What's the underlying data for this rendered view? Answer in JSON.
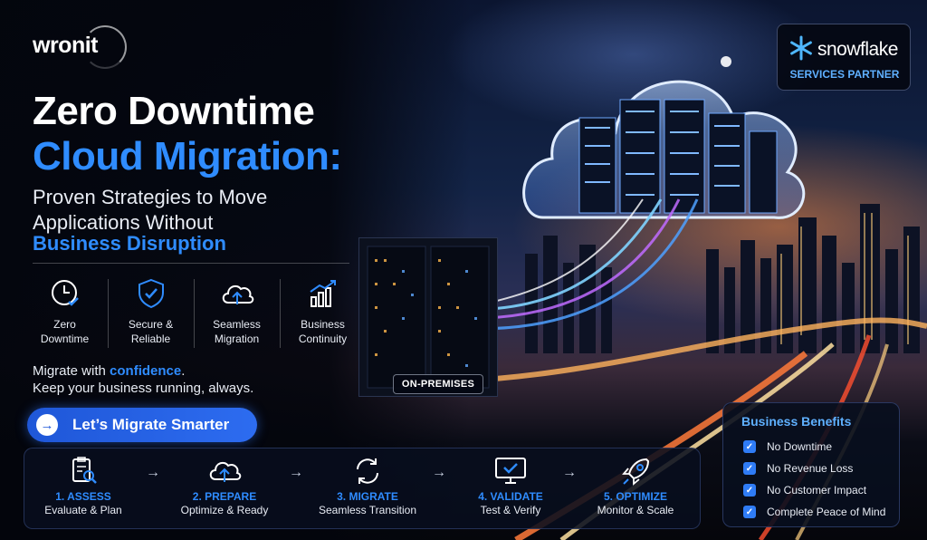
{
  "brand": {
    "name": "wronit"
  },
  "headline": {
    "line1": "Zero Downtime",
    "line2": "Cloud Migration:",
    "subtitle_line1": "Proven Strategies to Move",
    "subtitle_line2": "Applications Without",
    "subtitle_highlight": "Business Disruption"
  },
  "features": [
    {
      "icon": "clock-check-icon",
      "label": "Zero\nDowntime"
    },
    {
      "icon": "shield-check-icon",
      "label": "Secure &\nReliable"
    },
    {
      "icon": "cloud-upload-icon",
      "label": "Seamless\nMigration"
    },
    {
      "icon": "bar-chart-growth-icon",
      "label": "Business\nContinuity"
    }
  ],
  "tagline": {
    "prefix": "Migrate with ",
    "highlight": "confidence",
    "suffix": ".",
    "line2": "Keep your business running, always."
  },
  "cta": {
    "label": "Let’s Migrate Smarter",
    "icon": "arrow-right-icon"
  },
  "steps": [
    {
      "icon": "clipboard-search-icon",
      "title": "1. ASSESS",
      "subtitle": "Evaluate & Plan"
    },
    {
      "icon": "cloud-upload-icon",
      "title": "2. PREPARE",
      "subtitle": "Optimize & Ready"
    },
    {
      "icon": "sync-arrows-icon",
      "title": "3. MIGRATE",
      "subtitle": "Seamless Transition"
    },
    {
      "icon": "monitor-check-icon",
      "title": "4. VALIDATE",
      "subtitle": "Test & Verify"
    },
    {
      "icon": "rocket-icon",
      "title": "5. OPTIMIZE",
      "subtitle": "Monitor & Scale"
    }
  ],
  "partner": {
    "name": "snowflake",
    "label": "SERVICES PARTNER"
  },
  "onprem_label": "ON-PREMISES",
  "benefits": {
    "title": "Business Benefits",
    "items": [
      "No Downtime",
      "No Revenue Loss",
      "No Customer Impact",
      "Complete Peace of Mind"
    ]
  },
  "colors": {
    "accent": "#2f8cff",
    "cta": "#2d6cf0",
    "badge_text": "#5fb0ff"
  }
}
